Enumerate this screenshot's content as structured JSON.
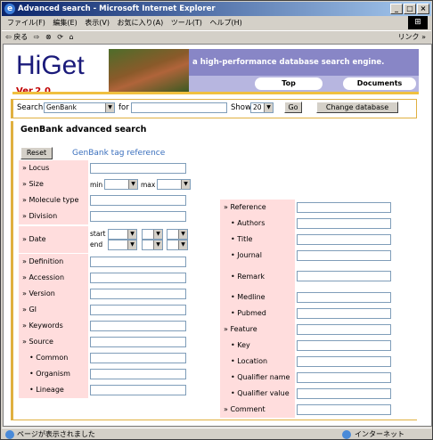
{
  "window": {
    "title": "Advanced search - Microsoft Internet Explorer",
    "minimize": "_",
    "maximize": "□",
    "close": "×"
  },
  "menu": [
    "ファイル(F)",
    "編集(E)",
    "表示(V)",
    "お気に入り(A)",
    "ツール(T)",
    "ヘルプ(H)"
  ],
  "toolbar": {
    "back": "⇦ 戻る",
    "forward": "⇨",
    "links": "リンク »"
  },
  "header": {
    "logo": "HiGet",
    "version": "Ver.2.0",
    "tagline": "a high-performance database search engine.",
    "nav": [
      "Top",
      "Documents"
    ]
  },
  "search": {
    "label": "Search",
    "db": "GenBank",
    "for": "for",
    "show": "Show",
    "count": "20",
    "go": "Go",
    "change": "Change database"
  },
  "form": {
    "title": "GenBank advanced search",
    "reset": "Reset",
    "reference_link": "GenBank tag reference"
  },
  "left_fields": [
    {
      "label": "» Locus",
      "type": "text"
    },
    {
      "label": "» Size",
      "type": "size",
      "min": "min",
      "max": "max"
    },
    {
      "label": "» Molecule type",
      "type": "text"
    },
    {
      "label": "» Division",
      "type": "text"
    },
    {
      "label": "» Date",
      "type": "date",
      "start": "start",
      "end": "end"
    },
    {
      "label": "» Definition",
      "type": "text"
    },
    {
      "label": "» Accession",
      "type": "text"
    },
    {
      "label": "» Version",
      "type": "text"
    },
    {
      "label": "» GI",
      "type": "text"
    },
    {
      "label": "» Keywords",
      "type": "text"
    },
    {
      "label": "» Source",
      "type": "text"
    },
    {
      "label": "• Common",
      "type": "text"
    },
    {
      "label": "• Organism",
      "type": "text"
    },
    {
      "label": "• Lineage",
      "type": "text"
    }
  ],
  "right_fields": [
    {
      "label": "» Reference"
    },
    {
      "label": "• Authors"
    },
    {
      "label": "• Title"
    },
    {
      "label": "• Journal"
    },
    {
      "label": "• Remark"
    },
    {
      "label": "• Medline"
    },
    {
      "label": "• Pubmed"
    },
    {
      "label": "» Feature"
    },
    {
      "label": "• Key"
    },
    {
      "label": "• Location"
    },
    {
      "label": "• Qualifier name"
    },
    {
      "label": "• Qualifier value"
    },
    {
      "label": "» Comment"
    }
  ],
  "statusbar": {
    "text": "ページが表示されました",
    "zone": "インターネット"
  }
}
